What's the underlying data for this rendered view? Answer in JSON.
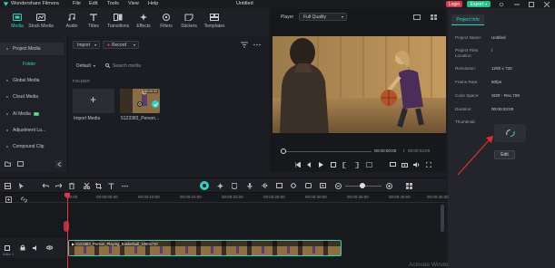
{
  "titlebar": {
    "app_name": "Wondershare Filmora",
    "menu": [
      "File",
      "Edit",
      "Tools",
      "View",
      "Help"
    ],
    "doc_title": "Untitled",
    "login_label": "Login",
    "export_label": "Export"
  },
  "toolbar": {
    "tools": [
      {
        "label": "Media",
        "icon": "media-icon"
      },
      {
        "label": "Stock Media",
        "icon": "stock-media-icon"
      },
      {
        "label": "Audio",
        "icon": "audio-icon"
      },
      {
        "label": "Titles",
        "icon": "titles-icon"
      },
      {
        "label": "Transitions",
        "icon": "transitions-icon"
      },
      {
        "label": "Effects",
        "icon": "effects-icon"
      },
      {
        "label": "Filters",
        "icon": "filters-icon"
      },
      {
        "label": "Stickers",
        "icon": "stickers-icon"
      },
      {
        "label": "Templates",
        "icon": "templates-icon"
      }
    ]
  },
  "sidebar": {
    "header": "Project Media",
    "folder": "Folder",
    "items": [
      {
        "label": "Global Media"
      },
      {
        "label": "Cloud Media"
      },
      {
        "label": "AI Media",
        "badge": "AI"
      },
      {
        "label": "Adjustment La..."
      },
      {
        "label": "Compound Clip"
      }
    ]
  },
  "media": {
    "import_label": "Import",
    "record_label": "Record",
    "default_label": "Default",
    "search_placeholder": "Search media",
    "folder_label": "FOLDER",
    "import_tile_label": "Import Media",
    "clip_label": "5123383_Person...",
    "clip_duration": "00:00:33"
  },
  "player": {
    "label": "Player",
    "quality": "Full Quality",
    "current_time": "00:00:00:00",
    "separator": "/",
    "total_time": "00:00:33:00"
  },
  "info": {
    "tab": "Project Info",
    "rows": [
      {
        "k": "Project Name:",
        "v": "Untitled"
      },
      {
        "k": "Project Files Location:",
        "v": "/"
      },
      {
        "k": "Resolution:",
        "v": "1280 x 720"
      },
      {
        "k": "Frame Rate:",
        "v": "50fps"
      },
      {
        "k": "Color Space:",
        "v": "SDR - Rec.709"
      },
      {
        "k": "Duration:",
        "v": "00:00:33:00"
      }
    ],
    "thumbnail_label": "Thumbnail:",
    "edit_label": "Edit"
  },
  "timeline": {
    "ticks": [
      "00:00",
      "00:00:05:00",
      "00:00:10:00",
      "00:00:15:00",
      "00:00:20:00",
      "00:00:25:00",
      "00:00:30:00",
      "00:00:35:00",
      "00:00:40:00",
      "00:00:45:00"
    ],
    "clip_label": "5123383_Person_Playing_Basketball_1080x720",
    "track_label": "Video 1",
    "watermark": "Activate Windo"
  },
  "colors": {
    "accent": "#2fd3c4",
    "export_green": "#22c28a",
    "login_red": "#d63b4b",
    "playhead": "#e0344a"
  }
}
